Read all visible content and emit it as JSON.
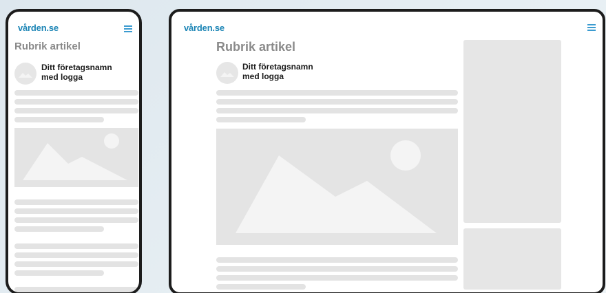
{
  "site": {
    "logo": "vården.se",
    "menu_icon": "hamburger-menu-icon",
    "accent_color": "#1e86b6"
  },
  "article": {
    "title": "Rubrik artikel",
    "company_line1": "Ditt företagsnamn",
    "company_line2": "med logga"
  },
  "icons": {
    "avatar": "logo-placeholder-icon",
    "image": "image-placeholder-icon"
  },
  "colors": {
    "placeholder_gray": "#e3e3e3",
    "title_gray": "#8a8a8a",
    "device_frame": "#1c1c1c"
  }
}
